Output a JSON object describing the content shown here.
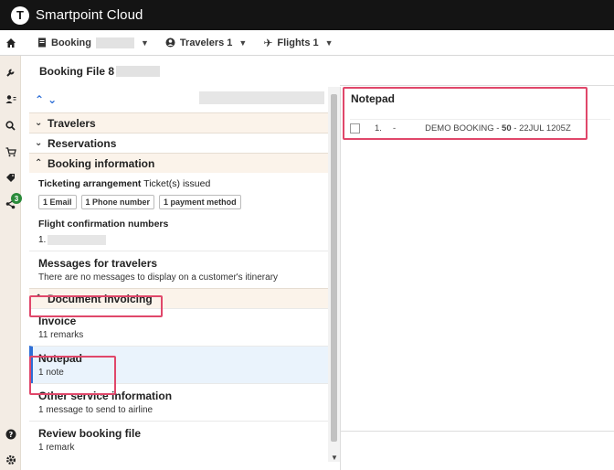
{
  "app": {
    "title": "Smartpoint Cloud",
    "logo_letter": "T"
  },
  "nav": {
    "booking_label": "Booking",
    "travelers_label": "Travelers 1",
    "flights_label": "Flights 1"
  },
  "rail": {
    "badge_count": "3"
  },
  "left_panel": {
    "title": "Booking File 8",
    "sections": {
      "travelers": "Travelers",
      "reservations": "Reservations",
      "booking_information": "Booking information",
      "document_invoicing": "Document invoicing"
    },
    "ticketing": {
      "label": "Ticketing arrangement",
      "value": "Ticket(s) issued"
    },
    "chips": [
      "1 Email",
      "1 Phone number",
      "1 payment method"
    ],
    "flight_confirmation": {
      "label": "Flight confirmation numbers",
      "first_index": "1."
    },
    "messages": {
      "title": "Messages for travelers",
      "subtitle": "There are no messages to display on a customer's itinerary"
    },
    "invoice": {
      "title": "Invoice",
      "subtitle": "11 remarks"
    },
    "notepad": {
      "title": "Notepad",
      "subtitle": "1 note"
    },
    "other_service": {
      "title": "Other service information",
      "subtitle": "1 message to send to airline"
    },
    "review": {
      "title": "Review booking file",
      "subtitle": "1 remark"
    }
  },
  "right_panel": {
    "title": "Notepad",
    "rows": [
      {
        "index": "1.",
        "dash": "-",
        "text_prefix": "DEMO BOOKING - ",
        "text_bold": "50",
        "text_suffix": " - 22JUL 1205Z"
      }
    ]
  },
  "colors": {
    "accent": "#2f6fd6",
    "highlight": "#e0476a",
    "topbar": "#141414",
    "rail": "#f3ece4",
    "section_bg": "#fbf3ea"
  }
}
